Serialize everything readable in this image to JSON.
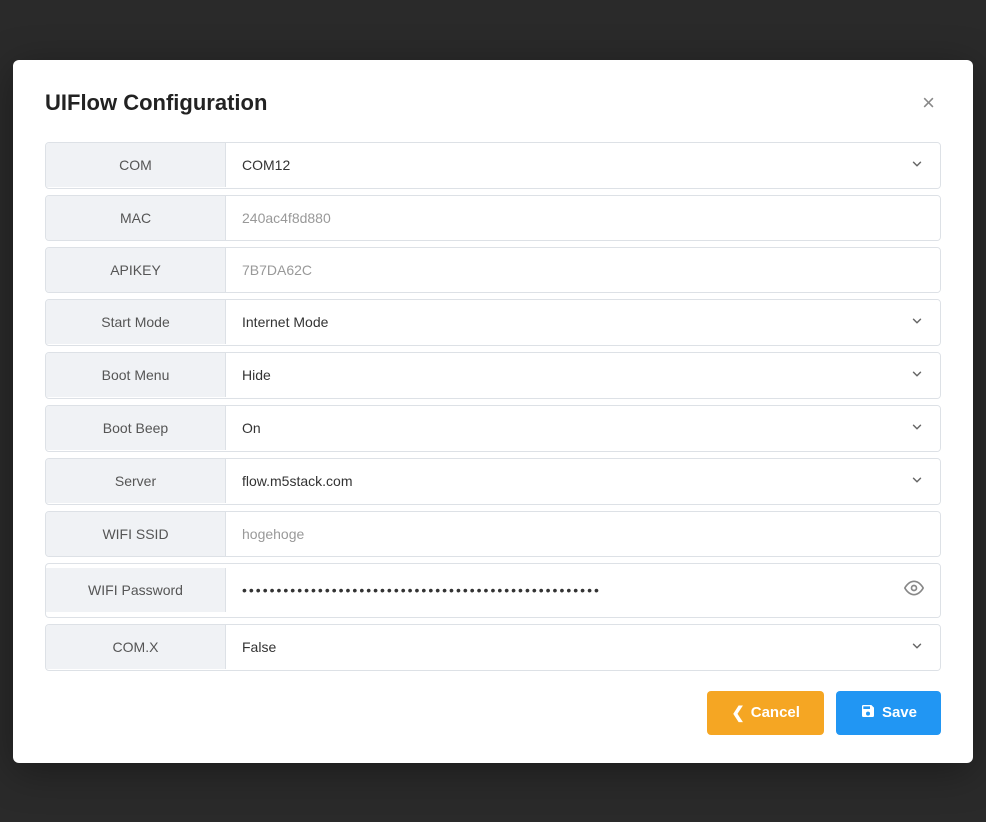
{
  "modal": {
    "title": "UIFlow Configuration",
    "close_label": "×"
  },
  "fields": [
    {
      "id": "com",
      "label": "COM",
      "value": "COM12",
      "type": "dropdown",
      "placeholder": ""
    },
    {
      "id": "mac",
      "label": "MAC",
      "value": "240ac4f8d880",
      "type": "text",
      "placeholder": ""
    },
    {
      "id": "apikey",
      "label": "APIKEY",
      "value": "7B7DA62C",
      "type": "text",
      "placeholder": ""
    },
    {
      "id": "start-mode",
      "label": "Start Mode",
      "value": "Internet Mode",
      "type": "dropdown",
      "placeholder": ""
    },
    {
      "id": "boot-menu",
      "label": "Boot Menu",
      "value": "Hide",
      "type": "dropdown",
      "placeholder": ""
    },
    {
      "id": "boot-beep",
      "label": "Boot Beep",
      "value": "On",
      "type": "dropdown",
      "placeholder": ""
    },
    {
      "id": "server",
      "label": "Server",
      "value": "flow.m5stack.com",
      "type": "dropdown",
      "placeholder": ""
    },
    {
      "id": "wifi-ssid",
      "label": "WIFI SSID",
      "value": "hogehoge",
      "type": "text",
      "placeholder": ""
    },
    {
      "id": "wifi-password",
      "label": "WIFI Password",
      "value": "••••••••••••••••••••••••••••••••••••••••••••••••••••",
      "type": "password",
      "placeholder": ""
    },
    {
      "id": "com-x",
      "label": "COM.X",
      "value": "False",
      "type": "dropdown",
      "placeholder": ""
    }
  ],
  "footer": {
    "cancel_label": "Cancel",
    "save_label": "Save",
    "cancel_icon": "‹",
    "save_icon": "💾"
  }
}
